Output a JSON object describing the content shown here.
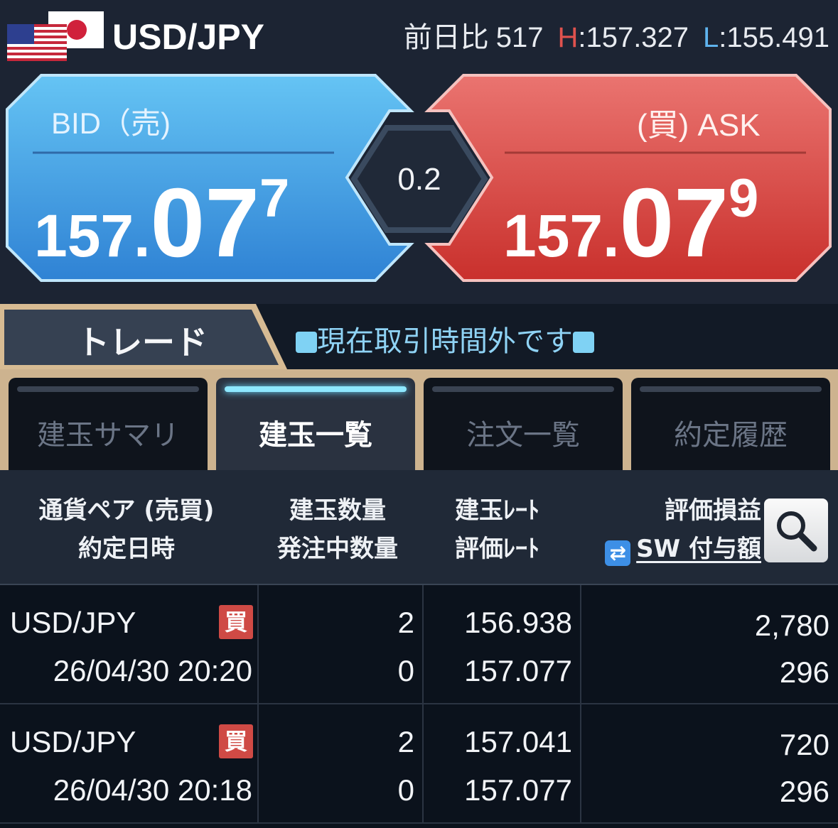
{
  "header": {
    "pair": "USD/JPY",
    "change_label": "前日比",
    "change_value": "517",
    "high_label": "H",
    "high_value": ":157.327",
    "low_label": "L",
    "low_value": ":155.491"
  },
  "bid": {
    "label": "BID（売)",
    "price_major": "157.",
    "price_big": "07",
    "price_sup": "7"
  },
  "ask": {
    "label": "(買) ASK",
    "price_major": "157.",
    "price_big": "07",
    "price_sup": "9"
  },
  "spread": "0.2",
  "trade_tab": "トレード",
  "market_status": "現在取引時間外です",
  "subtabs": [
    {
      "label": "建玉サマリ"
    },
    {
      "label": "建玉一覧"
    },
    {
      "label": "注文一覧"
    },
    {
      "label": "約定履歴"
    }
  ],
  "columns": {
    "c1a": "通貨ペア (売買)",
    "c1b": "約定日時",
    "c2a": "建玉数量",
    "c2b": "発注中数量",
    "c3a": "建玉ﾚｰﾄ",
    "c3b": "評価ﾚｰﾄ",
    "c4a": "評価損益",
    "c4b": "SW 付与額"
  },
  "positions": [
    {
      "pair": "USD/JPY",
      "side": "買",
      "datetime": "26/04/30 20:20",
      "qty": "2",
      "order_qty": "0",
      "rate": "156.938",
      "eval_rate": "157.077",
      "pl": "2,780",
      "swap": "296"
    },
    {
      "pair": "USD/JPY",
      "side": "買",
      "datetime": "26/04/30 20:18",
      "qty": "2",
      "order_qty": "0",
      "rate": "157.041",
      "eval_rate": "157.077",
      "pl": "720",
      "swap": "296"
    }
  ],
  "colors": {
    "bid": "#4aa8ec",
    "ask": "#e0524e",
    "accent_tab": "#8ee8ff",
    "badge_buy": "#cf4a45"
  }
}
